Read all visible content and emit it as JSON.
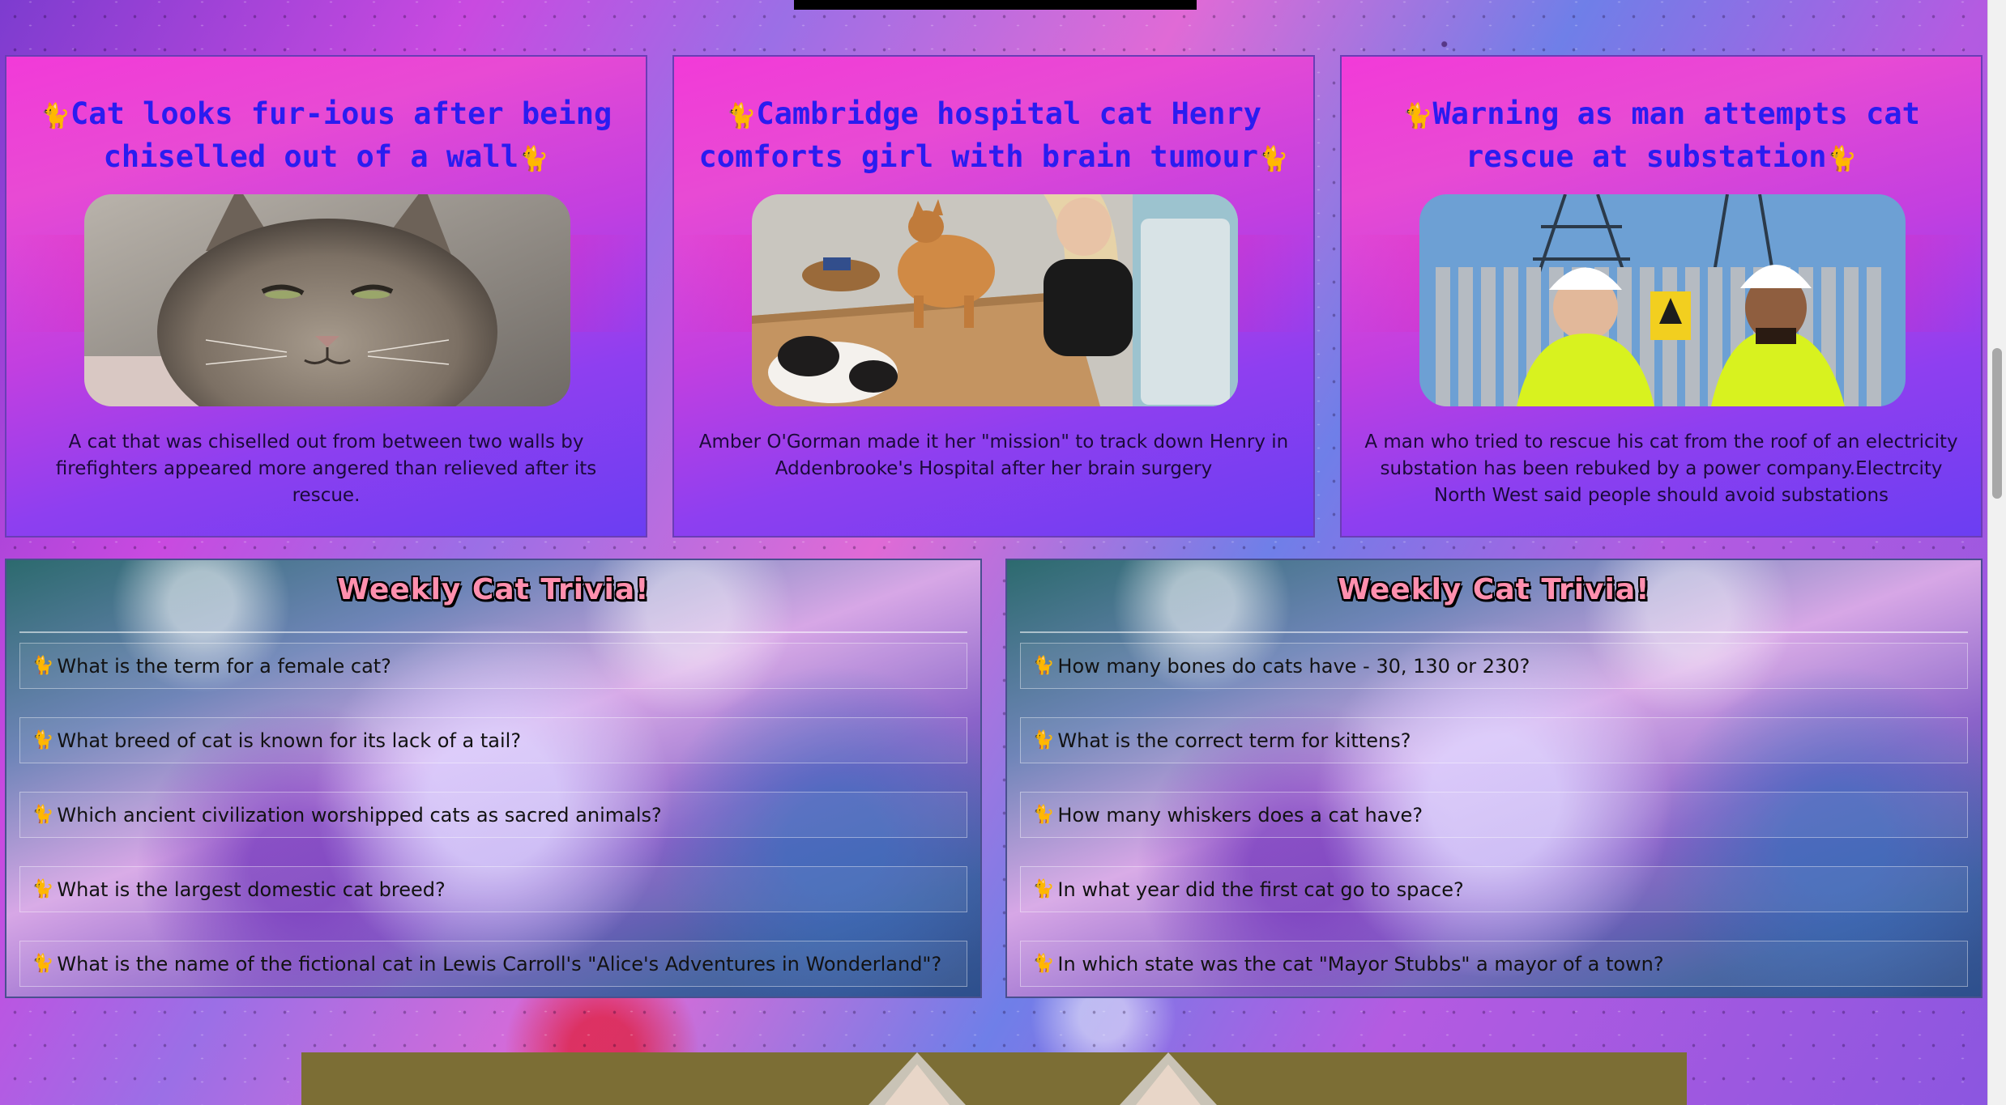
{
  "news": [
    {
      "title": "Cat looks fur-ious after being chiselled out of a wall",
      "emoji": "🐈",
      "description": "A cat that was chiselled out from between two walls by firefighters appeared more angered than relieved after its rescue."
    },
    {
      "title": "Cambridge hospital cat Henry comforts girl with brain tumour",
      "emoji": "🐈",
      "description": "Amber O'Gorman made it her \"mission\" to track down Henry in Addenbrooke's Hospital after her brain surgery"
    },
    {
      "title": "Warning as man attempts cat rescue at substation",
      "emoji": "🐈",
      "description": "A man who tried to rescue his cat from the roof of an electricity substation has been rebuked by a power company.Electrcity North West said people should avoid substations"
    }
  ],
  "trivia": [
    {
      "title": "Weekly Cat Trivia!",
      "questions": [
        "What is the term for a female cat?",
        "What breed of cat is known for its lack of a tail?",
        "Which ancient civilization worshipped cats as sacred animals?",
        "What is the largest domestic cat breed?",
        "What is the name of the fictional cat in Lewis Carroll's \"Alice's Adventures in Wonderland\"?"
      ]
    },
    {
      "title": "Weekly Cat Trivia!",
      "questions": [
        "How many bones do cats have - 30, 130 or 230?",
        "What is the correct term for kittens?",
        "How many whiskers does a cat have?",
        "In what year did the first cat go to space?",
        "In which state was the cat \"Mayor Stubbs\" a mayor of a town?"
      ]
    }
  ],
  "icons": {
    "cat": "cat-emoji-icon"
  },
  "colors": {
    "headline": "#2a1cf0",
    "card_top": "#f23ad8",
    "card_bottom": "#6b3ef2",
    "trivia_title": "#ff8fae"
  }
}
